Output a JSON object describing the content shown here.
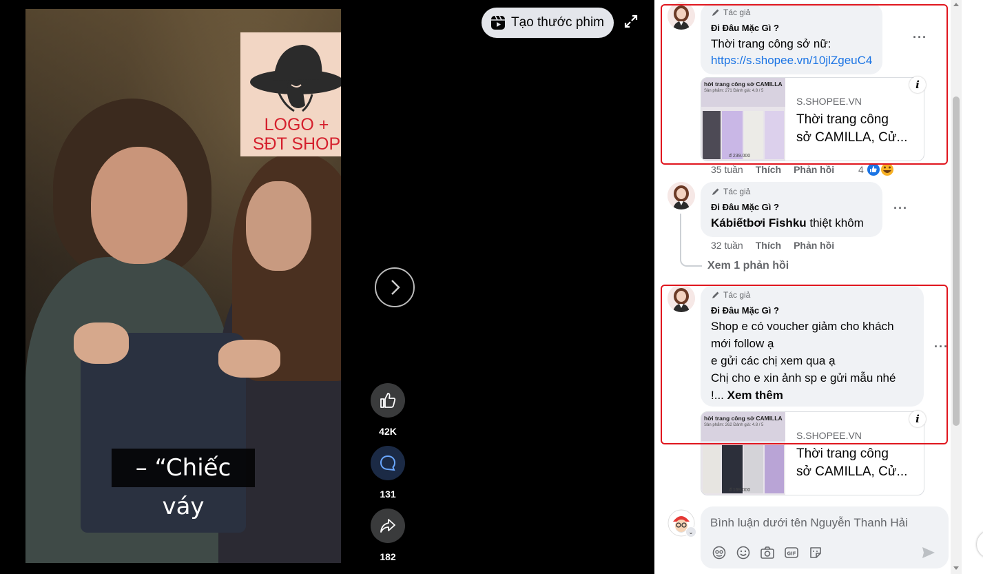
{
  "video": {
    "logo_lines": [
      "LOGO +",
      "SĐT SHOP"
    ],
    "subtitle": "– “Chiếc váy",
    "create_reel_label": "Tạo thước phim",
    "actions": [
      {
        "name": "like",
        "icon": "thumbs-up-icon",
        "count": "42K"
      },
      {
        "name": "comment",
        "icon": "comment-icon",
        "count": "131"
      },
      {
        "name": "share",
        "icon": "share-icon",
        "count": "182"
      }
    ]
  },
  "comments": [
    {
      "badge": "Tác giả",
      "author": "Đi Đâu Mặc Gì ?",
      "lines": [
        "Thời trang công sở nữ:"
      ],
      "link": "https://s.shopee.vn/10jlZgeuC4",
      "card": {
        "thumb_title": "hời trang công sở CAMILLA",
        "thumb_meta": "Sản phẩm: 271   Đánh giá: 4.8 / 5",
        "thumb_price": "đ 239.000",
        "domain": "S.SHOPEE.VN",
        "title_lines": [
          "Thời trang công",
          "sở CAMILLA, Cử..."
        ]
      },
      "time": "35 tuần",
      "like_label": "Thích",
      "reply_label": "Phản hồi",
      "reaction_count": "4"
    },
    {
      "badge": "Tác giả",
      "author": "Đi Đâu Mặc Gì ?",
      "mention": "Kábiếtbơi Fishku",
      "text_after_mention": " thiệt khôm",
      "time": "32 tuần",
      "like_label": "Thích",
      "reply_label": "Phản hồi",
      "view_replies": "Xem 1 phản hồi"
    },
    {
      "badge": "Tác giả",
      "author": "Đi Đâu Mặc Gì ?",
      "lines": [
        "Shop e có voucher giảm cho khách",
        "mới follow ạ",
        "e gửi các chị xem qua ạ",
        "Chị cho e xin ảnh sp e gửi mẫu nhé"
      ],
      "last_line_prefix": "!... ",
      "see_more": "Xem thêm",
      "card": {
        "thumb_title": "hời trang công sở CAMILLA",
        "thumb_meta": "Sản phẩm: 262   Đánh giá: 4.8 / 5",
        "thumb_price": "đ 169.000",
        "domain": "S.SHOPEE.VN",
        "title_lines": [
          "Thời trang công",
          "sở CAMILLA, Cử..."
        ]
      }
    }
  ],
  "composer": {
    "placeholder": "Bình luận dưới tên Nguyễn Thanh Hải",
    "tools": [
      "sticker-avatar-icon",
      "emoji-icon",
      "camera-icon",
      "gif-icon",
      "sticker-icon"
    ],
    "send_icon": "send-icon"
  },
  "colors": {
    "link": "#1b74e4",
    "highlight": "#e0161e",
    "bubble": "#f0f2f5",
    "logo_text": "#d5202d"
  }
}
